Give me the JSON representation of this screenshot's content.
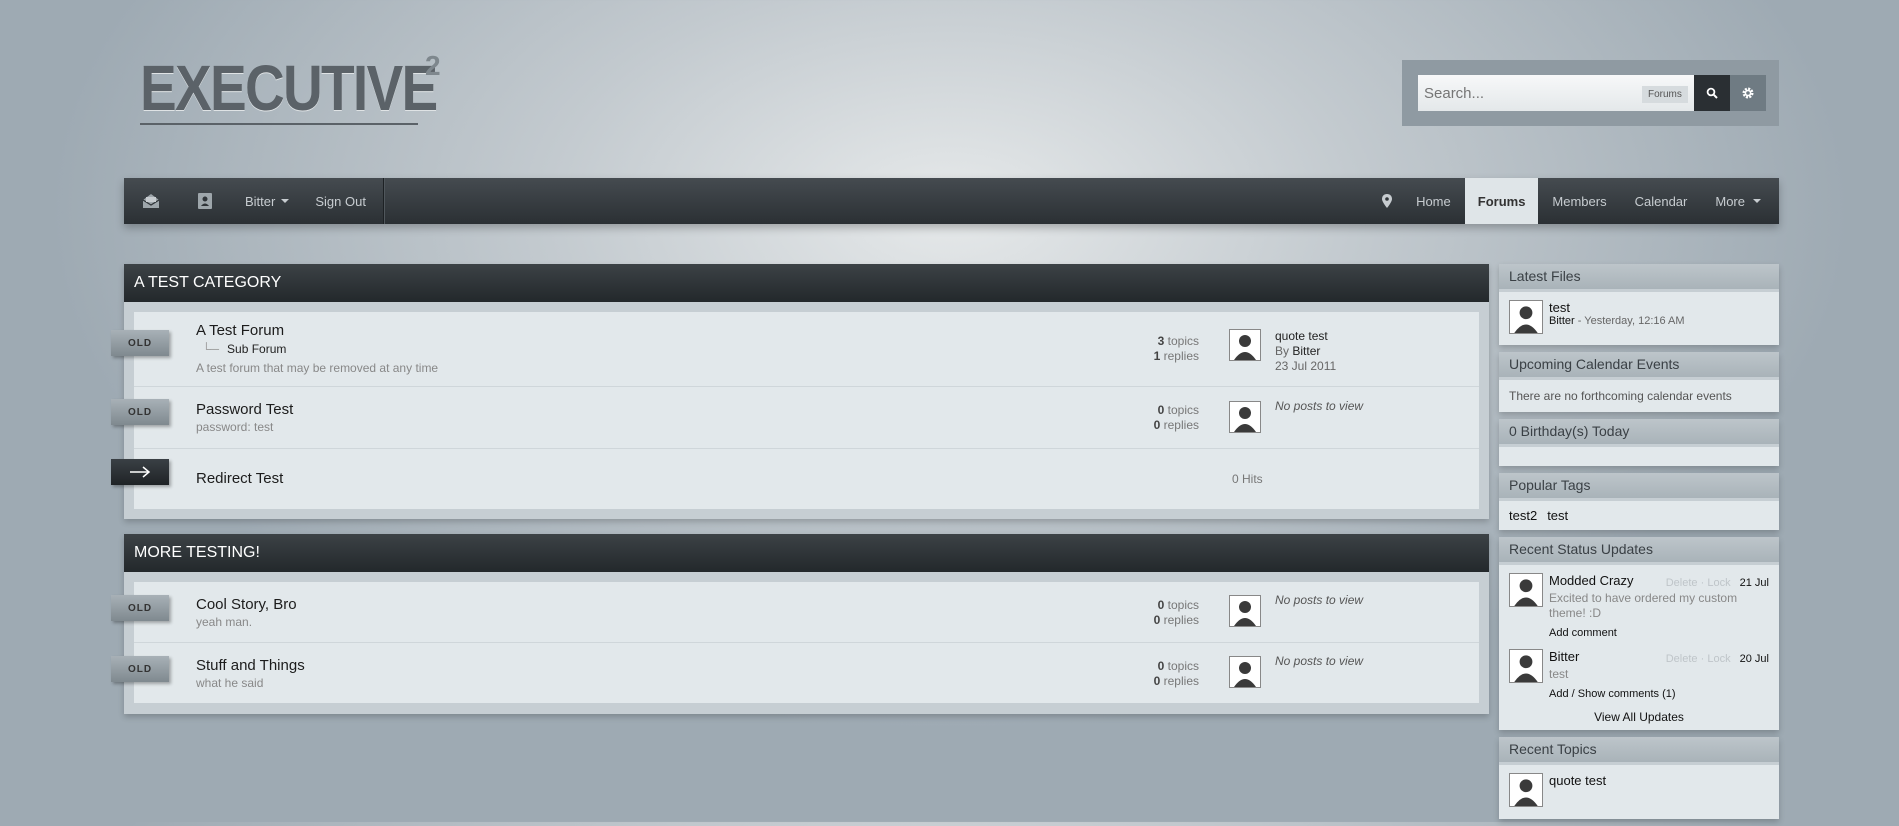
{
  "logo": {
    "text": "EXECUTIVE",
    "superscript": "2"
  },
  "search": {
    "placeholder": "Search...",
    "scope": "Forums"
  },
  "icons": {
    "search": "search-icon",
    "settings": "gear-icon",
    "messenger": "envelope-icon",
    "notifications": "id-badge-icon",
    "location": "map-pin-icon"
  },
  "nav": {
    "user": "Bitter",
    "sign_out": "Sign Out",
    "tabs": [
      {
        "label": "Home"
      },
      {
        "label": "Forums",
        "active": true
      },
      {
        "label": "Members"
      },
      {
        "label": "Calendar"
      },
      {
        "label": "More"
      }
    ]
  },
  "categories": [
    {
      "title": "A Test Category",
      "forums": [
        {
          "badge": "OLD",
          "name": "A Test Forum",
          "subforum": "Sub Forum",
          "description": "A test forum that may be removed at any time",
          "topics": "3",
          "replies": "1",
          "topics_label": "topics",
          "replies_label": "replies",
          "last_title": "quote test",
          "last_by_prefix": "By",
          "last_by": "Bitter",
          "last_date": "23 Jul 2011"
        },
        {
          "badge": "OLD",
          "name": "Password Test",
          "description": "password: test",
          "topics": "0",
          "replies": "0",
          "topics_label": "topics",
          "replies_label": "replies",
          "no_posts": "No posts to view"
        },
        {
          "badge": "arrow",
          "name": "Redirect Test",
          "hits": "0 Hits"
        }
      ]
    },
    {
      "title": "More Testing!",
      "forums": [
        {
          "badge": "OLD",
          "name": "Cool Story, Bro",
          "description": "yeah man.",
          "topics": "0",
          "replies": "0",
          "topics_label": "topics",
          "replies_label": "replies",
          "no_posts": "No posts to view"
        },
        {
          "badge": "OLD",
          "name": "Stuff and Things",
          "description": "what he said",
          "topics": "0",
          "replies": "0",
          "topics_label": "topics",
          "replies_label": "replies",
          "no_posts": "No posts to view"
        }
      ]
    }
  ],
  "sidebar": {
    "latest_files": {
      "title": "Latest Files",
      "item": {
        "name": "test",
        "author": "Bitter",
        "when": " - Yesterday, 12:16 AM"
      }
    },
    "calendar": {
      "title": "Upcoming Calendar Events",
      "text": "There are no forthcoming calendar events"
    },
    "birthdays": {
      "title": "0 Birthday(s) Today"
    },
    "tags": {
      "title": "Popular Tags",
      "items": [
        "test2",
        "test"
      ]
    },
    "status": {
      "title": "Recent Status Updates",
      "delete_label": "Delete",
      "lock_label": "Lock",
      "separator": "·",
      "items": [
        {
          "name": "Modded Crazy",
          "date": "21 Jul",
          "text": "Excited to have ordered my custom theme! :D",
          "link": "Add comment"
        },
        {
          "name": "Bitter",
          "date": "20 Jul",
          "text": "test",
          "link": "Add / Show comments (1)"
        }
      ],
      "view_all": "View All Updates"
    },
    "recent_topics": {
      "title": "Recent Topics",
      "item": "quote test"
    }
  }
}
